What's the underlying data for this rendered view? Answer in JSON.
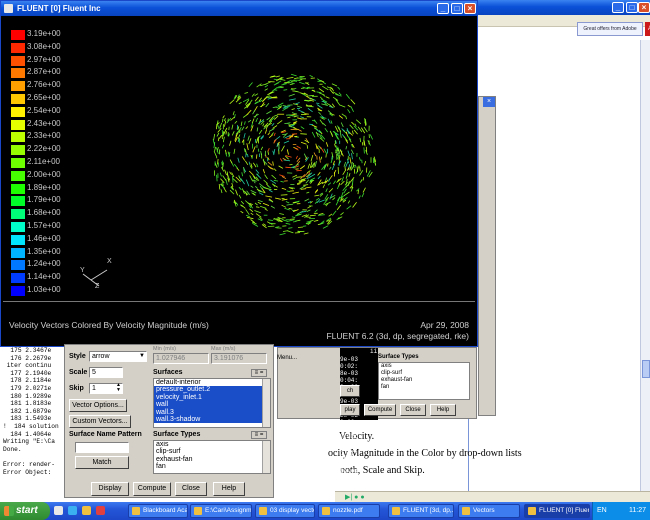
{
  "fluent_window": {
    "title": "FLUENT [0] Fluent Inc",
    "legend": [
      {
        "value": "3.19e+00",
        "color": "#ff0000"
      },
      {
        "value": "3.08e+00",
        "color": "#ff2800"
      },
      {
        "value": "2.97e+00",
        "color": "#ff5000"
      },
      {
        "value": "2.87e+00",
        "color": "#ff7800"
      },
      {
        "value": "2.76e+00",
        "color": "#ffa000"
      },
      {
        "value": "2.65e+00",
        "color": "#ffc800"
      },
      {
        "value": "2.54e+00",
        "color": "#fff000"
      },
      {
        "value": "2.43e+00",
        "color": "#e6ff00"
      },
      {
        "value": "2.33e+00",
        "color": "#beff00"
      },
      {
        "value": "2.22e+00",
        "color": "#96ff00"
      },
      {
        "value": "2.11e+00",
        "color": "#6eff00"
      },
      {
        "value": "2.00e+00",
        "color": "#46ff00"
      },
      {
        "value": "1.89e+00",
        "color": "#1eff00"
      },
      {
        "value": "1.79e+00",
        "color": "#00ff28"
      },
      {
        "value": "1.68e+00",
        "color": "#00ff78"
      },
      {
        "value": "1.57e+00",
        "color": "#00ffc8"
      },
      {
        "value": "1.46e+00",
        "color": "#00e6ff"
      },
      {
        "value": "1.35e+00",
        "color": "#00b4ff"
      },
      {
        "value": "1.24e+00",
        "color": "#0078ff"
      },
      {
        "value": "1.14e+00",
        "color": "#003cff"
      },
      {
        "value": "1.03e+00",
        "color": "#0000ff"
      }
    ],
    "axes": {
      "y": "Y",
      "x": "X",
      "z": "Z"
    },
    "caption_left": "Velocity Vectors Colored By Velocity Magnitude (m/s)",
    "caption_date": "Apr 29, 2008",
    "caption_version": "FLUENT 6.2 (3d, dp, segregated, rke)"
  },
  "console": {
    "lines": [
      "  175 2.3467e",
      "  176 2.2679e",
      " iter continu",
      "  177 2.1940e",
      "  178 2.1184e",
      "  179 2.0271e",
      "  180 1.9289e",
      "  181 1.8183e",
      "  182 1.6879e",
      "  183 1.5493e",
      "!  184 solution",
      "  184 1.4064e",
      "Writing \"E:\\Ca",
      "Done.",
      "",
      "Error: render-",
      "Error Object:"
    ]
  },
  "vectors_dialog": {
    "min_label": "Min (m/s)",
    "max_label": "Max (m/s)",
    "min_value": "1.027946",
    "max_value": "3.191076",
    "style_label": "Style",
    "style_value": "arrow",
    "scale_label": "Scale",
    "scale_value": "5",
    "skip_label": "Skip",
    "skip_value": "1",
    "vector_options": "Vector Options...",
    "custom_vectors": "Custom Vectors...",
    "surface_name_pattern": "Surface Name Pattern",
    "match": "Match",
    "surfaces_label": "Surfaces",
    "surfaces": [
      {
        "name": "default-interior",
        "selected": false
      },
      {
        "name": "pressure_outlet.2",
        "selected": true
      },
      {
        "name": "velocity_inlet.1",
        "selected": true
      },
      {
        "name": "wall",
        "selected": true
      },
      {
        "name": "wall.3",
        "selected": true
      },
      {
        "name": "wall.3-shadow",
        "selected": true
      }
    ],
    "surface_types_label": "Surface Types",
    "surface_types": [
      "axis",
      "clip-surf",
      "exhaust-fan",
      "fan"
    ],
    "display": "Display",
    "compute": "Compute",
    "close": "Close",
    "help": "Help",
    "menu": "Menu..."
  },
  "back_panel": {
    "col_header": "ii",
    "rows": [
      {
        "a": "9e-03",
        "b": "0:02:"
      },
      {
        "a": "8e-03",
        "b": "0:04:"
      },
      {
        "a": "9e-03",
        "b": "0:04:"
      },
      {
        "a": "9e-03",
        "b": "0:02:"
      },
      {
        "a": "2e-03",
        "b": "0:03:"
      },
      {
        "a": "0e-03",
        "b": "0:02:"
      },
      {
        "a": "6e-03",
        "b": "0:02:"
      },
      {
        "a": "2e-04",
        "b": "0:03:"
      },
      {
        "a": "0e-04",
        "b": "0:02:"
      }
    ],
    "surface_types_label": "Surface Types",
    "surface_types": [
      "axis",
      "clip-surf",
      "exhaust-fan",
      "fan"
    ],
    "btn_ch": "ch",
    "btn_display": "play",
    "btn_compute": "Compute",
    "btn_close": "Close",
    "btn_help": "Help"
  },
  "browser": {
    "ad_text": "Great offers from Adobe",
    "adobe_logo": "A",
    "doc_lines": [
      "Velocity.",
      "ocity Magnitude in the Color by drop-down lists",
      "ooth, Scale and Skip."
    ]
  },
  "taskbar": {
    "start": "start",
    "tasks": [
      {
        "label": "Blackboard Acad...",
        "active": false
      },
      {
        "label": "E:\\Cari\\Assignme...",
        "active": false
      },
      {
        "label": "03 display vector-...",
        "active": false
      },
      {
        "label": "nozzle.pdf",
        "active": false
      },
      {
        "label": "FLUENT [3d, dp,...",
        "active": false
      },
      {
        "label": "Vectors",
        "active": false
      },
      {
        "label": "FLUENT [0] Fluen...",
        "active": true
      }
    ],
    "lang": "EN",
    "time": "11:27"
  },
  "colors": {
    "xp_blue": "#0a50d8",
    "dialog_gray": "#d4d0c8",
    "selection_blue": "#1a4ec8"
  }
}
